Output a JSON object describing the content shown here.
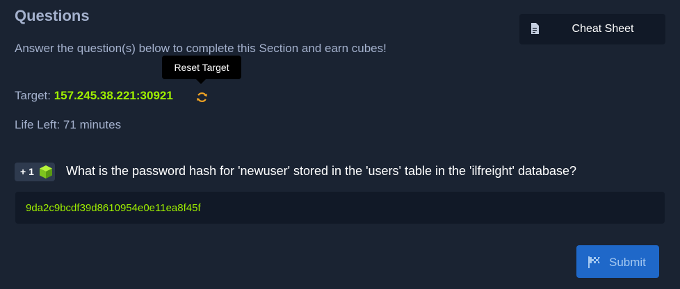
{
  "section": {
    "title": "Questions",
    "subtitle": "Answer the question(s) below to complete this Section and earn cubes!"
  },
  "cheat_sheet": {
    "label": "Cheat Sheet",
    "icon": "document-icon"
  },
  "tooltip": {
    "text": "Reset Target"
  },
  "target": {
    "label": "Target: ",
    "value": "157.245.38.221:30921",
    "reset_icon": "refresh-icon"
  },
  "life": {
    "text": "Life Left: 71 minutes"
  },
  "question": {
    "reward": "+ 1",
    "reward_icon": "cube-icon",
    "text": "What is the password hash for 'newuser' stored in the 'users' table in the 'ilfreight' database?",
    "answer": "9da2c9bcdf39d8610954e0e11ea8f45f"
  },
  "submit": {
    "label": "Submit",
    "icon": "flag-icon"
  },
  "colors": {
    "background": "#1a2332",
    "accent_green": "#9fef00",
    "submit_blue": "#1f68c9",
    "muted_text": "#a4b1cd"
  }
}
